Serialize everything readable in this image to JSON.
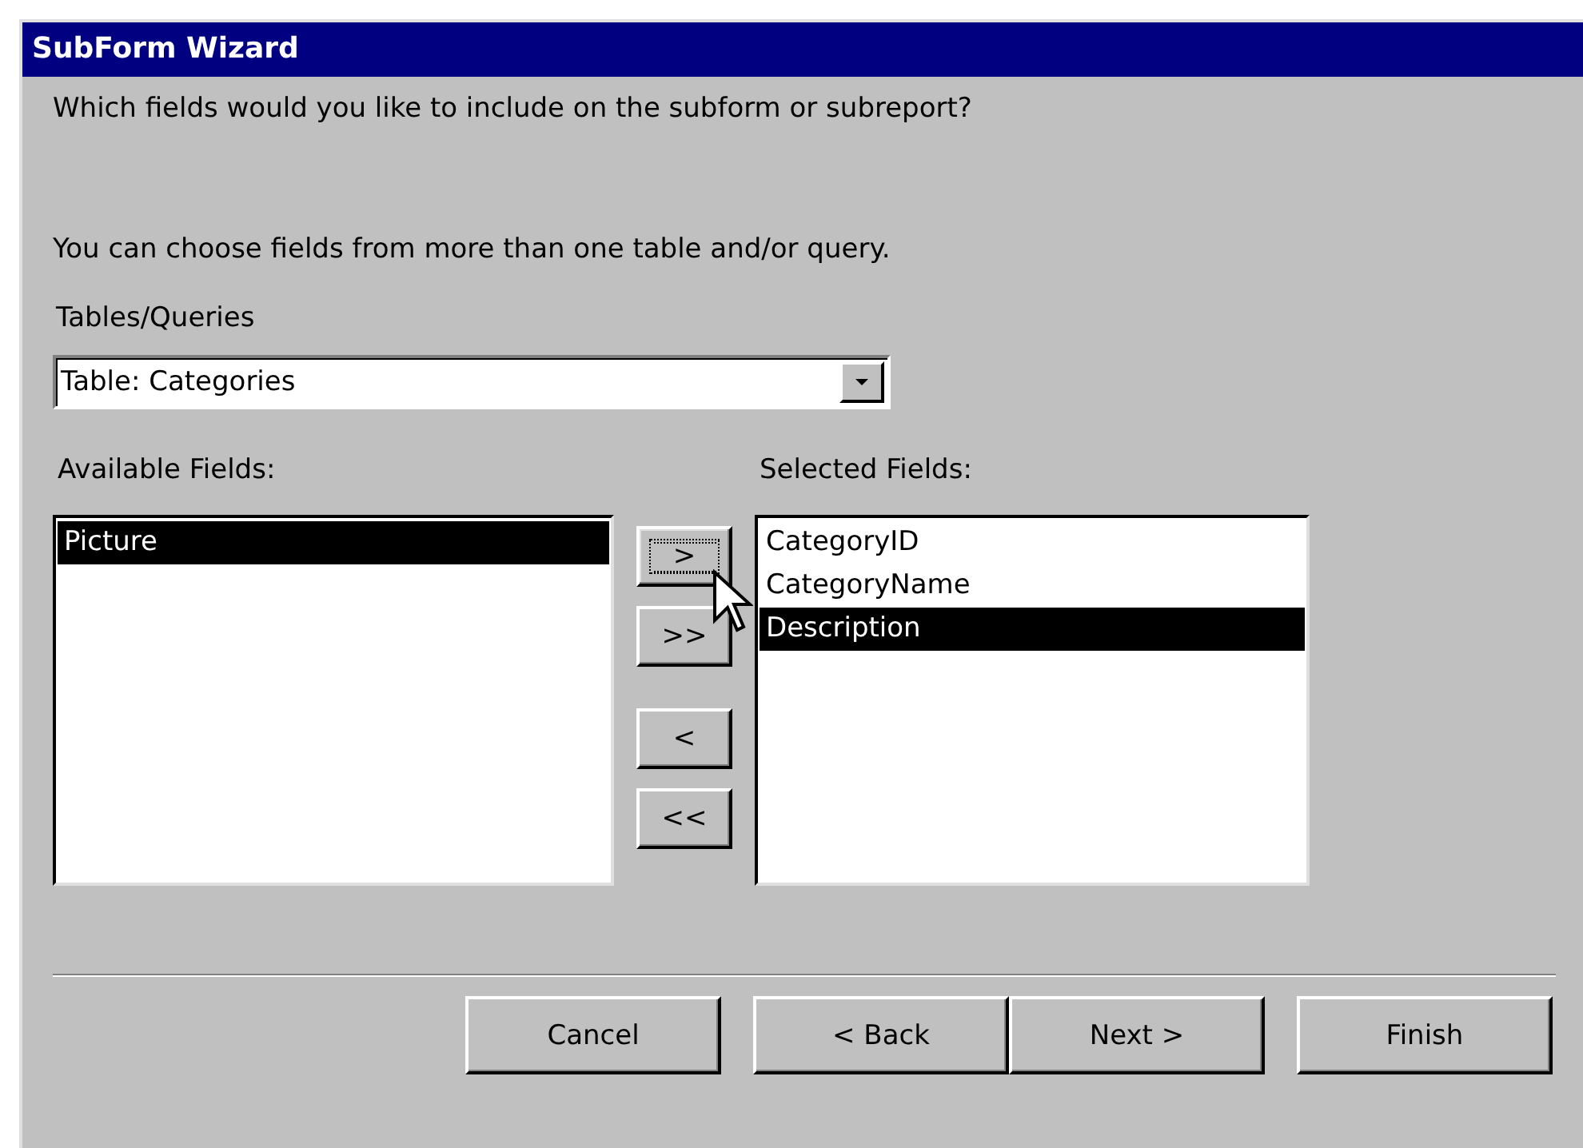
{
  "window": {
    "title": "SubForm Wizard"
  },
  "question": "Which fields would you like to include on the subform or subreport?",
  "hint": "You can choose fields from more than one table and/or query.",
  "tables_queries": {
    "label": "Tables/Queries",
    "value": "Table: Categories"
  },
  "available_fields": {
    "label": "Available Fields:",
    "items": [
      {
        "text": "Picture",
        "selected": true
      }
    ]
  },
  "move_buttons": [
    {
      "label": ">",
      "focused": true
    },
    {
      "label": ">>",
      "focused": false
    },
    {
      "label": "<",
      "focused": false
    },
    {
      "label": "<<",
      "focused": false
    }
  ],
  "selected_fields": {
    "label": "Selected Fields:",
    "items": [
      {
        "text": "CategoryID",
        "selected": false
      },
      {
        "text": "CategoryName",
        "selected": false
      },
      {
        "text": "Description",
        "selected": true
      }
    ]
  },
  "buttons": [
    {
      "label": "Cancel"
    },
    {
      "label": "< Back"
    },
    {
      "label": "Next >"
    },
    {
      "label": "Finish"
    }
  ]
}
